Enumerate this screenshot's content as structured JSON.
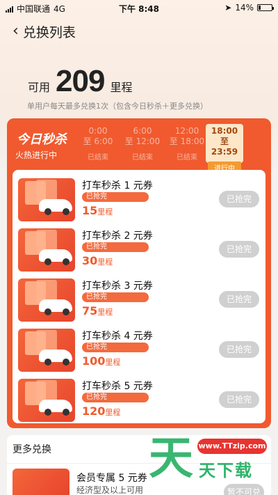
{
  "status_bar": {
    "carrier": "中国联通",
    "network": "4G",
    "time": "下午 8:48",
    "battery": "14%",
    "battery_level": 0.14
  },
  "nav": {
    "title": "兑换列表",
    "back_icon": "chevron-left-icon"
  },
  "points": {
    "label": "可用",
    "value": "209",
    "unit": "里程",
    "rule": "单用户每天最多兑换1次（包含今日秒杀＋更多兑换）"
  },
  "flash_sale": {
    "title": "今日秒杀",
    "subtitle": "火热进行中",
    "slots": [
      {
        "start": "0:00",
        "end": "至 6:00",
        "status": "已结束",
        "active": false
      },
      {
        "start": "6:00",
        "end": "至 12:00",
        "status": "已结束",
        "active": false
      },
      {
        "start": "12:00",
        "end": "至 18:00",
        "status": "已结束",
        "active": false
      },
      {
        "start": "18:00",
        "end": "至 23:59",
        "status": "进行中",
        "active": true
      }
    ],
    "items": [
      {
        "title": "打车秒杀 1 元券",
        "tag": "已抢完",
        "price": "15",
        "price_unit": "里程",
        "button": "已抢完"
      },
      {
        "title": "打车秒杀 2 元券",
        "tag": "已抢完",
        "price": "30",
        "price_unit": "里程",
        "button": "已抢完"
      },
      {
        "title": "打车秒杀 3 元券",
        "tag": "已抢完",
        "price": "75",
        "price_unit": "里程",
        "button": "已抢完"
      },
      {
        "title": "打车秒杀 4 元券",
        "tag": "已抢完",
        "price": "100",
        "price_unit": "里程",
        "button": "已抢完"
      },
      {
        "title": "打车秒杀 5 元券",
        "tag": "已抢完",
        "price": "120",
        "price_unit": "里程",
        "button": "已抢完"
      }
    ]
  },
  "more": {
    "title": "更多兑换",
    "item": {
      "title": "会员专属 5 元券",
      "desc": "经济型及以上可用",
      "button": "暂不可兑"
    }
  },
  "watermark": {
    "big": "天",
    "url": "www.TTzip.com",
    "small": "天下载"
  },
  "colors": {
    "accent": "#f05a2e",
    "price": "#f15a2a",
    "disabled": "#d0d0d0",
    "active_slot": "#fde7c8",
    "watermark_green": "#2fb36a",
    "watermark_red": "#e9332f"
  }
}
